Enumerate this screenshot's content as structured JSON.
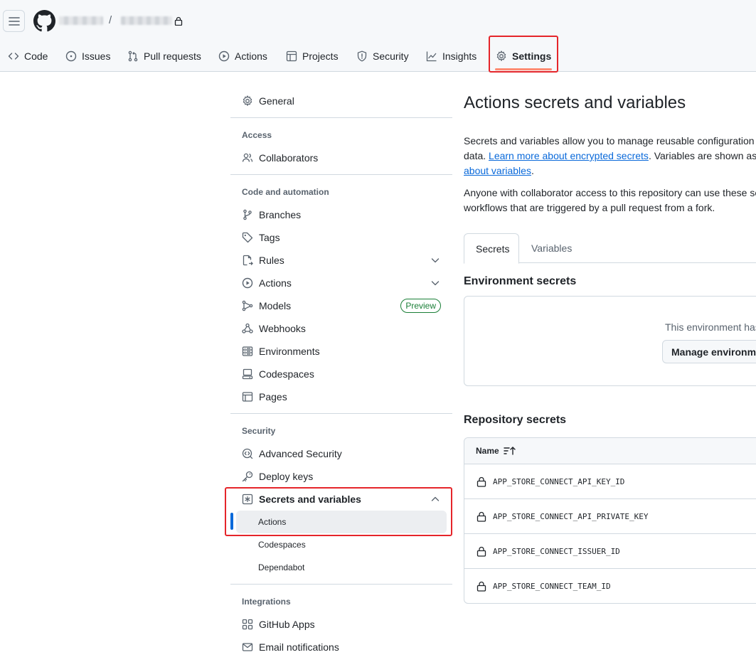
{
  "header": {
    "nav_tabs": [
      {
        "label": "Code",
        "icon": "code-icon"
      },
      {
        "label": "Issues",
        "icon": "issue-icon"
      },
      {
        "label": "Pull requests",
        "icon": "pull-request-icon"
      },
      {
        "label": "Actions",
        "icon": "play-icon"
      },
      {
        "label": "Projects",
        "icon": "table-icon"
      },
      {
        "label": "Security",
        "icon": "shield-icon"
      },
      {
        "label": "Insights",
        "icon": "graph-icon"
      },
      {
        "label": "Settings",
        "icon": "gear-icon",
        "selected": true
      }
    ],
    "breadcrumb_separator": "/",
    "accent_underline": "#fd8c73",
    "annotation_color": "#e5252a"
  },
  "sidebar": {
    "general": "General",
    "access_heading": "Access",
    "collaborators": "Collaborators",
    "code_heading": "Code and automation",
    "code_items": [
      "Branches",
      "Tags",
      "Rules",
      "Actions",
      "Models",
      "Webhooks",
      "Environments",
      "Codespaces",
      "Pages"
    ],
    "models_badge": "Preview",
    "security_heading": "Security",
    "security_items": [
      "Advanced Security",
      "Deploy keys",
      "Secrets and variables"
    ],
    "secrets_subitems": [
      "Actions",
      "Codespaces",
      "Dependabot"
    ],
    "integrations_heading": "Integrations",
    "integrations_items": [
      "GitHub Apps",
      "Email notifications"
    ]
  },
  "main": {
    "title": "Actions secrets and variables",
    "intro_line1": "Secrets and variables allow you to manage reusable configuration d",
    "intro_line2_pre": "data. ",
    "intro_link1": "Learn more about encrypted secrets",
    "intro_line2_post": ". Variables are shown as p",
    "intro_link2": "about variables",
    "intro_line3_post": ".",
    "access_line1": "Anyone with collaborator access to this repository can use these se",
    "access_line2": "workflows that are triggered by a pull request from a fork.",
    "tabs": [
      "Secrets",
      "Variables"
    ],
    "env_secrets_title": "Environment secrets",
    "env_empty_text": "This environment has",
    "env_button": "Manage environme",
    "repo_secrets_title": "Repository secrets",
    "repo_column": "Name",
    "secrets": [
      "APP_STORE_CONNECT_API_KEY_ID",
      "APP_STORE_CONNECT_API_PRIVATE_KEY",
      "APP_STORE_CONNECT_ISSUER_ID",
      "APP_STORE_CONNECT_TEAM_ID"
    ]
  }
}
